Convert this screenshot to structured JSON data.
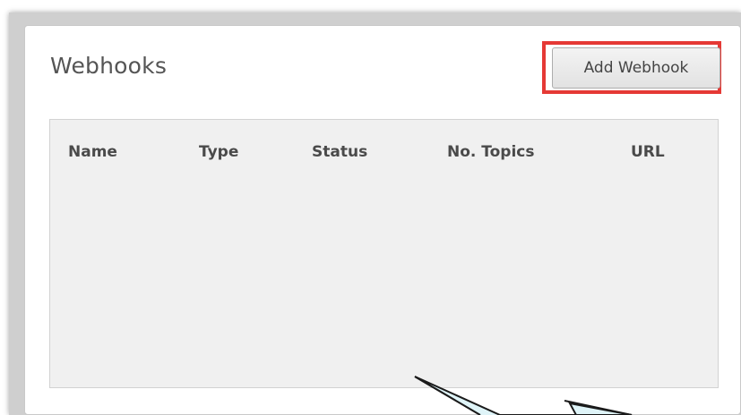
{
  "panel": {
    "title": "Webhooks",
    "add_button_label": "Add Webhook"
  },
  "table": {
    "columns": [
      "Name",
      "Type",
      "Status",
      "No. Topics",
      "URL"
    ],
    "rows": []
  },
  "colors": {
    "highlight": "#e53935",
    "callout_fill": "#dff4f8",
    "table_bg": "#f0f0f0"
  }
}
